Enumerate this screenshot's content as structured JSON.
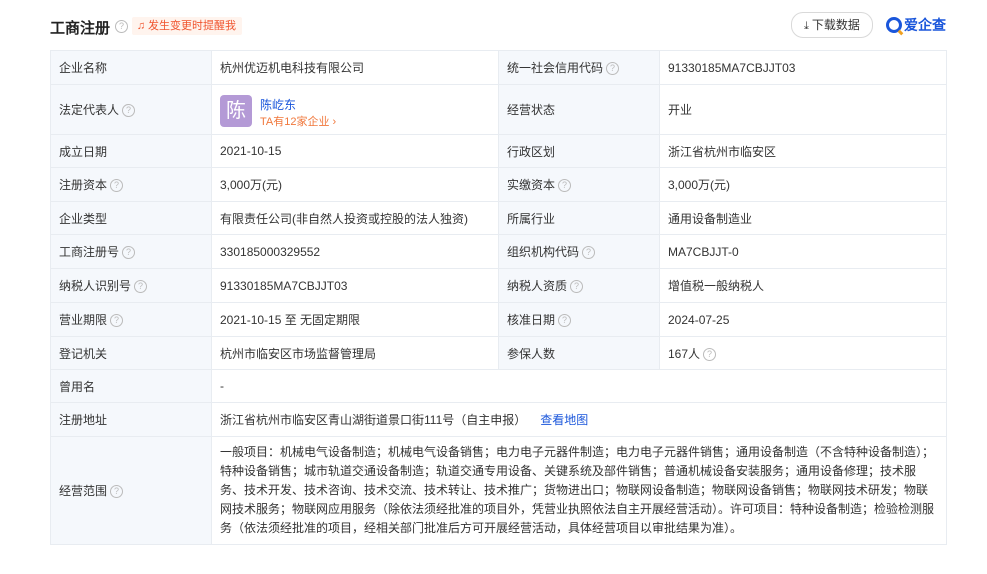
{
  "header": {
    "title": "工商注册",
    "alert": "发生变更时提醒我",
    "download": "下载数据",
    "brand": "爱企查"
  },
  "rows": [
    {
      "l1": "企业名称",
      "v1": "杭州优迈机电科技有限公司",
      "l2": "统一社会信用代码",
      "v2": "91330185MA7CBJJT03"
    },
    {
      "l1": "法定代表人",
      "l2": "经营状态",
      "v2": "开业"
    },
    {
      "l1": "成立日期",
      "v1": "2021-10-15",
      "l2": "行政区划",
      "v2": "浙江省杭州市临安区"
    },
    {
      "l1": "注册资本",
      "v1": "3,000万(元)",
      "l2": "实缴资本",
      "v2": "3,000万(元)"
    },
    {
      "l1": "企业类型",
      "v1": "有限责任公司(非自然人投资或控股的法人独资)",
      "l2": "所属行业",
      "v2": "通用设备制造业"
    },
    {
      "l1": "工商注册号",
      "v1": "330185000329552",
      "l2": "组织机构代码",
      "v2": "MA7CBJJT-0"
    },
    {
      "l1": "纳税人识别号",
      "v1": "91330185MA7CBJJT03",
      "l2": "纳税人资质",
      "v2": "增值税一般纳税人"
    },
    {
      "l1": "营业期限",
      "v1": "2021-10-15 至 无固定期限",
      "l2": "核准日期",
      "v2": "2024-07-25"
    },
    {
      "l1": "登记机关",
      "v1": "杭州市临安区市场监督管理局",
      "l2": "参保人数",
      "v2": "167人"
    },
    {
      "l1": "曾用名",
      "v1": "-"
    },
    {
      "l1": "注册地址",
      "v1": "浙江省杭州市临安区青山湖街道景口街111号（自主申报）",
      "link": "查看地图"
    },
    {
      "l1": "经营范围",
      "v1": "一般项目：机械电气设备制造；机械电气设备销售；电力电子元器件制造；电力电子元器件销售；通用设备制造（不含特种设备制造）；特种设备销售；城市轨道交通设备制造；轨道交通专用设备、关键系统及部件销售；普通机械设备安装服务；通用设备修理；技术服务、技术开发、技术咨询、技术交流、技术转让、技术推广；货物进出口；物联网设备制造；物联网设备销售；物联网技术研发；物联网技术服务；物联网应用服务（除依法须经批准的项目外，凭营业执照依法自主开展经营活动）。许可项目：特种设备制造；检验检测服务（依法须经批准的项目，经相关部门批准后方可开展经营活动，具体经营项目以审批结果为准）。"
    }
  ],
  "representative": {
    "avatar_char": "陈",
    "name": "陈屹东",
    "companies": "TA有12家企业",
    "chevron": "›"
  },
  "icons": {
    "help": "?",
    "bell": "♫",
    "download": "⤓"
  }
}
